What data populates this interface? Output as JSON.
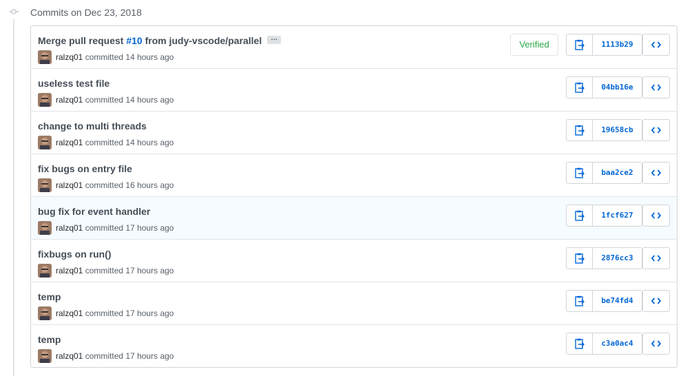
{
  "group": {
    "title": "Commits on Dec 23, 2018"
  },
  "labels": {
    "committed": "committed",
    "verified": "Verified",
    "ellipsis": "…"
  },
  "commits": [
    {
      "title_prefix": "Merge pull request ",
      "pr_link": "#10",
      "title_suffix": " from judy-vscode/parallel",
      "author": "ralzq01",
      "time": "14 hours ago",
      "sha": "1113b29",
      "verified": true
    },
    {
      "title": "useless test file",
      "author": "ralzq01",
      "time": "14 hours ago",
      "sha": "04bb16e"
    },
    {
      "title": "change to multi threads",
      "author": "ralzq01",
      "time": "14 hours ago",
      "sha": "19658cb"
    },
    {
      "title": "fix bugs on entry file",
      "author": "ralzq01",
      "time": "16 hours ago",
      "sha": "baa2ce2"
    },
    {
      "title": "bug fix for event handler",
      "author": "ralzq01",
      "time": "17 hours ago",
      "sha": "1fcf627"
    },
    {
      "title": "fixbugs on run()",
      "author": "ralzq01",
      "time": "17 hours ago",
      "sha": "2876cc3"
    },
    {
      "title": "temp",
      "author": "ralzq01",
      "time": "17 hours ago",
      "sha": "be74fd4"
    },
    {
      "title": "temp",
      "author": "ralzq01",
      "time": "17 hours ago",
      "sha": "c3a0ac4"
    }
  ],
  "icons": {
    "commit_node": "git-commit-icon",
    "copy": "clipboard-icon",
    "browse": "code-icon",
    "avatar": "user-avatar"
  },
  "colors": {
    "link": "#0366d6",
    "verified": "#28a745",
    "text_muted": "#586069",
    "border": "#d1d5da",
    "highlight_row": "#f6fbff"
  }
}
